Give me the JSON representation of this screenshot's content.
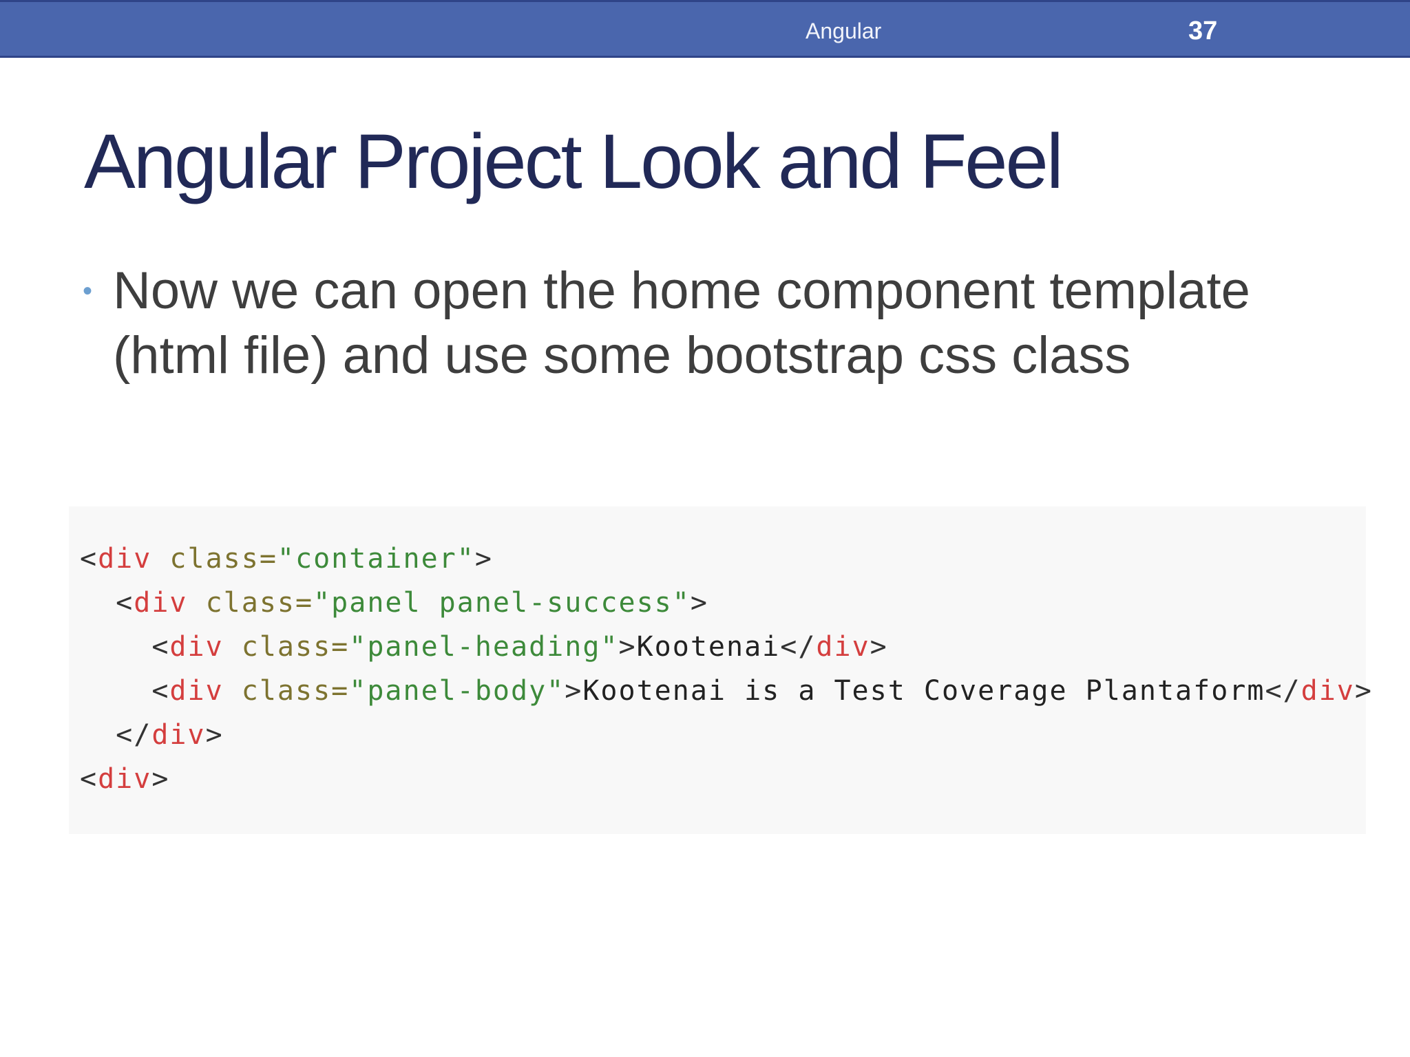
{
  "header": {
    "deck_title": "Angular",
    "slide_number": "37"
  },
  "title": "Angular Project Look and Feel",
  "bullets": [
    {
      "marker": "•",
      "line1": "Now we can open the home component template",
      "line2": "(html file) and use some bootstrap css class"
    }
  ],
  "code": {
    "lines": [
      {
        "indent": "",
        "open": "<",
        "tag": "div",
        "attr": " class=",
        "value": "\"container\"",
        "close": ">",
        "text": "",
        "close_open": "",
        "close_tag": "",
        "close_end": ""
      },
      {
        "indent": "  ",
        "open": "<",
        "tag": "div",
        "attr": " class=",
        "value": "\"panel panel-success\"",
        "close": ">",
        "text": "",
        "close_open": "",
        "close_tag": "",
        "close_end": ""
      },
      {
        "indent": "    ",
        "open": "<",
        "tag": "div",
        "attr": " class=",
        "value": "\"panel-heading\"",
        "close": ">",
        "text": "Kootenai",
        "close_open": "</",
        "close_tag": "div",
        "close_end": ">"
      },
      {
        "indent": "    ",
        "open": "<",
        "tag": "div",
        "attr": " class=",
        "value": "\"panel-body\"",
        "close": ">",
        "text": "Kootenai is a Test Coverage Plantaform",
        "close_open": "</",
        "close_tag": "div",
        "close_end": ">"
      },
      {
        "indent": "  ",
        "open": "</",
        "tag": "div",
        "attr": "",
        "value": "",
        "close": ">",
        "text": "",
        "close_open": "",
        "close_tag": "",
        "close_end": ""
      },
      {
        "indent": "",
        "open": "<",
        "tag": "div",
        "attr": "",
        "value": "",
        "close": ">",
        "text": "",
        "close_open": "",
        "close_tag": "",
        "close_end": ""
      }
    ]
  },
  "colors": {
    "header_bar": "#4a66ad",
    "title": "#212957",
    "bullet_marker": "#6c9fd0",
    "body_text": "#3e3e3e",
    "code_tag": "#d43e3e",
    "code_attr": "#7d7330",
    "code_string": "#3d8a3a",
    "code_background": "#f8f8f8"
  }
}
